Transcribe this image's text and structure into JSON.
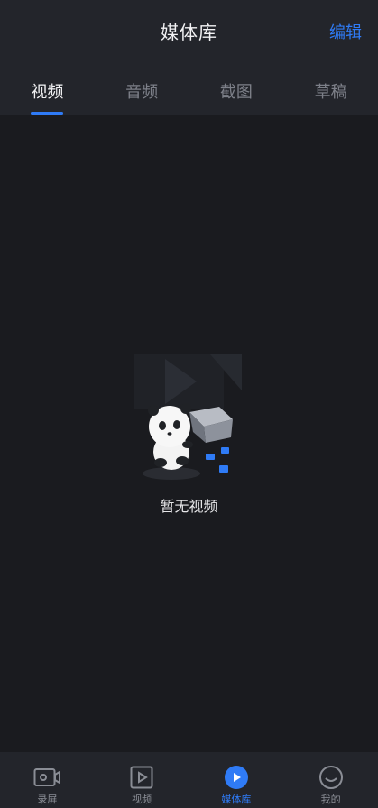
{
  "header": {
    "title": "媒体库",
    "edit_label": "编辑"
  },
  "tabs": [
    {
      "label": "视频",
      "active": true
    },
    {
      "label": "音频",
      "active": false
    },
    {
      "label": "截图",
      "active": false
    },
    {
      "label": "草稿",
      "active": false
    }
  ],
  "empty_state": {
    "text": "暂无视频",
    "illustration": "panda-with-box-illustration"
  },
  "tabbar": [
    {
      "label": "录屏",
      "icon": "record-camera-icon",
      "active": false
    },
    {
      "label": "视频",
      "icon": "video-play-icon",
      "active": false
    },
    {
      "label": "媒体库",
      "icon": "media-library-icon",
      "active": true
    },
    {
      "label": "我的",
      "icon": "profile-smile-icon",
      "active": false
    }
  ],
  "colors": {
    "accent": "#2f7bf6",
    "background": "#1a1b1f",
    "header_bg": "#23252b"
  }
}
